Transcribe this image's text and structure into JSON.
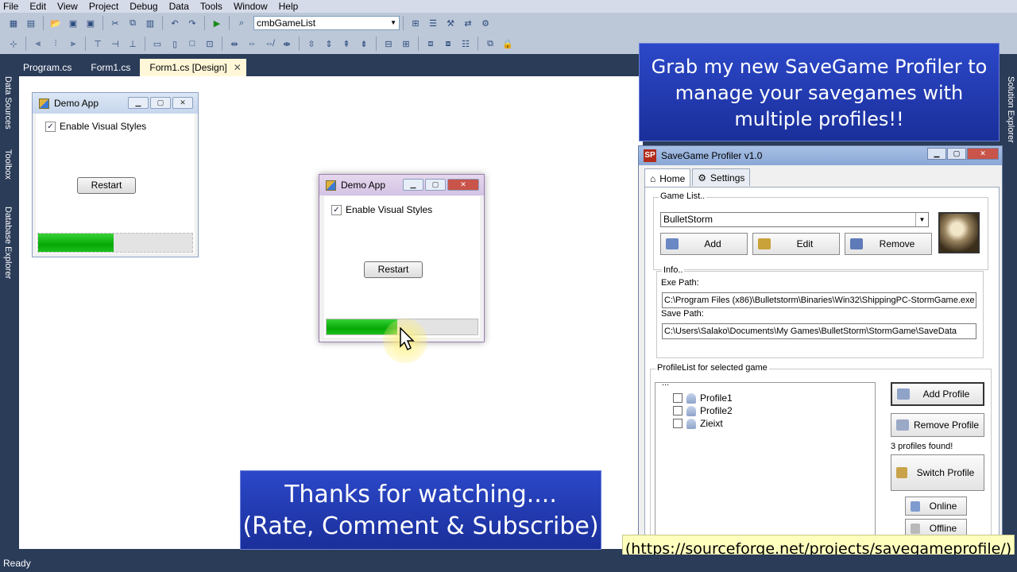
{
  "menu": [
    "File",
    "Edit",
    "View",
    "Project",
    "Debug",
    "Data",
    "Tools",
    "Window",
    "Help"
  ],
  "toolbar": {
    "combo_value": "cmbGameList"
  },
  "side_tabs": {
    "left": [
      "Data Sources",
      "Toolbox",
      "Database Explorer"
    ],
    "right": "Solution Explorer"
  },
  "doc_tabs": [
    {
      "label": "Program.cs"
    },
    {
      "label": "Form1.cs"
    },
    {
      "label": "Form1.cs [Design]"
    }
  ],
  "status": "Ready",
  "designer_form": {
    "title": "Demo App",
    "checkbox_label": "Enable Visual Styles",
    "checked": true,
    "button": "Restart",
    "progress": 0.49
  },
  "running_form": {
    "title": "Demo App",
    "checkbox_label": "Enable Visual Styles",
    "checked": true,
    "button": "Restart",
    "progress": 0.47
  },
  "banner_top": [
    "Grab my new SaveGame Profiler to",
    "manage your savegames with",
    "multiple profiles!!"
  ],
  "banner_bottom": [
    "Thanks for watching....",
    "(Rate, Comment & Subscribe)"
  ],
  "url": "(https://sourceforge.net/projects/savegameprofile/)",
  "sgp": {
    "title": "SaveGame Profiler v1.0",
    "logo": "SP",
    "tabs": [
      "Home",
      "Settings"
    ],
    "game_list_legend": "Game List..",
    "game_selected": "BulletStorm",
    "game_buttons": [
      "Add",
      "Edit",
      "Remove"
    ],
    "info_legend": "Info..",
    "exe_label": "Exe Path:",
    "exe_path": "C:\\Program Files (x86)\\Bulletstorm\\Binaries\\Win32\\ShippingPC-StormGame.exe",
    "save_label": "Save Path:",
    "save_path": "C:\\Users\\Salako\\Documents\\My Games\\BulletStorm\\StormGame\\SaveData",
    "profile_legend": "ProfileList for selected game",
    "tree_root": "...",
    "profiles": [
      "Profile1",
      "Profile2",
      "Zieixt"
    ],
    "btn_add_profile": "Add Profile",
    "btn_remove_profile": "Remove Profile",
    "profiles_found": "3 profiles found!",
    "btn_switch": "Switch Profile",
    "btn_online": "Online",
    "btn_offline": "Offline"
  },
  "colors": {
    "ide_bg": "#2b3c59",
    "banner": "#2238b0",
    "progress": "#06b006",
    "url_bg": "#ffffbe"
  }
}
